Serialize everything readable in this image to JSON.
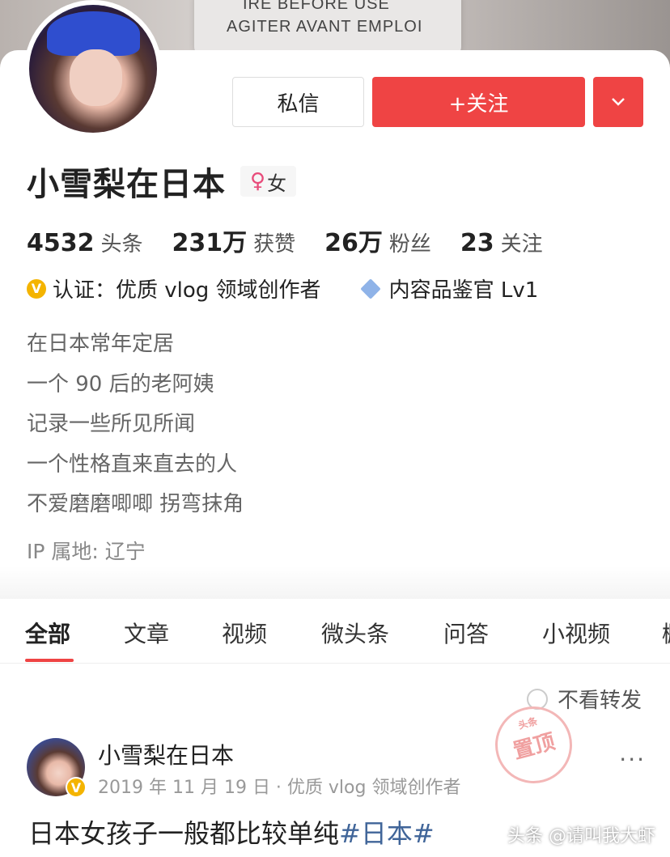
{
  "banner": {
    "line1": "IRE BEFORE USE",
    "line2": "AGITER AVANT EMPLOI"
  },
  "profile": {
    "name": "小雪梨在日本",
    "gender_symbol": "♀",
    "gender": "女",
    "message_button": "私信",
    "follow_button": "+关注",
    "more_icon": "chevron-down-icon"
  },
  "stats": [
    {
      "num": "4532",
      "label": "头条"
    },
    {
      "num": "231万",
      "label": "获赞"
    },
    {
      "num": "26万",
      "label": "粉丝"
    },
    {
      "num": "23",
      "label": "关注"
    }
  ],
  "certs": {
    "badge": "V",
    "verify": "认证：优质 vlog 领域创作者",
    "level": "内容品鉴官 Lv1"
  },
  "bio": [
    "在日本常年定居",
    "一个 90 后的老阿姨",
    "记录一些所见所闻",
    "一个性格直来直去的人",
    "不爱磨磨唧唧 拐弯抹角"
  ],
  "ip": "IP 属地: 辽宁",
  "tabs": [
    "全部",
    "文章",
    "视频",
    "微头条",
    "问答",
    "小视频",
    "橱"
  ],
  "filter_label": "不看转发",
  "pinned": {
    "top": "头条",
    "label": "置顶"
  },
  "post": {
    "badge": "V",
    "author": "小雪梨在日本",
    "meta": "2019 年 11 月 19 日 · 优质 vlog 领域创作者",
    "more": "···",
    "text": "日本女孩子一般都比较单纯",
    "tag": "#日本#"
  },
  "watermark": "头条 @请叫我大虾",
  "colors": {
    "accent": "#ef4444",
    "link": "#406599",
    "badge": "#f4b400"
  }
}
